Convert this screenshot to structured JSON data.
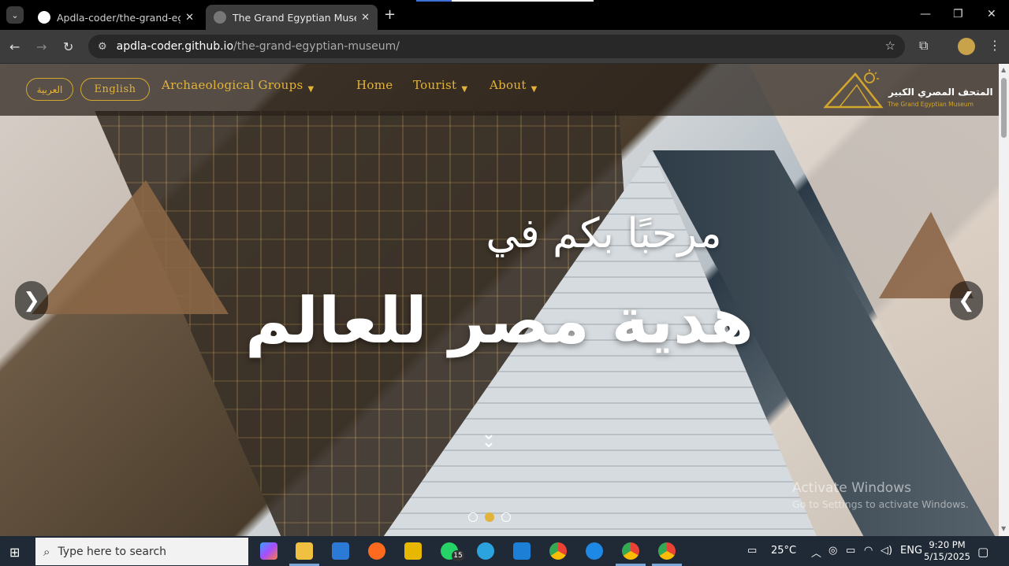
{
  "browser": {
    "tabs": [
      {
        "title": "Apdla-coder/the-grand-egyptia",
        "active": false
      },
      {
        "title": "The Grand Egyptian Museum",
        "active": true
      }
    ],
    "url_host": "apdla-coder.github.io",
    "url_path": "/the-grand-egyptian-museum/"
  },
  "header": {
    "lang_arabic": "العربية",
    "lang_english": "English",
    "nav": [
      {
        "label": "Archaeological Groups",
        "has_dropdown": true
      },
      {
        "label": "Home",
        "has_dropdown": false
      },
      {
        "label": "Tourist",
        "has_dropdown": true
      },
      {
        "label": "About",
        "has_dropdown": true
      }
    ],
    "logo_ar": "المتحف المصري الكبير",
    "logo_en": "The Grand Egyptian Museum"
  },
  "hero": {
    "line1": "مرحبًا بكم في",
    "line2": "هدية مصر للعالم",
    "prev": "❯",
    "next": "❮",
    "scroll_hint": "︾",
    "slides": 3,
    "active_slide": 2
  },
  "watermark": {
    "title": "Activate Windows",
    "subtitle": "Go to Settings to activate Windows."
  },
  "taskbar": {
    "search_placeholder": "Type here to search",
    "weather": "25°C",
    "lang": "ENG",
    "time": "9:20 PM",
    "date": "5/15/2025",
    "whatsapp_badge": "15"
  },
  "colors": {
    "accent_gold": "#e2b33b",
    "header_bg": "#28201a",
    "taskbar_bg": "#1f2a36"
  }
}
